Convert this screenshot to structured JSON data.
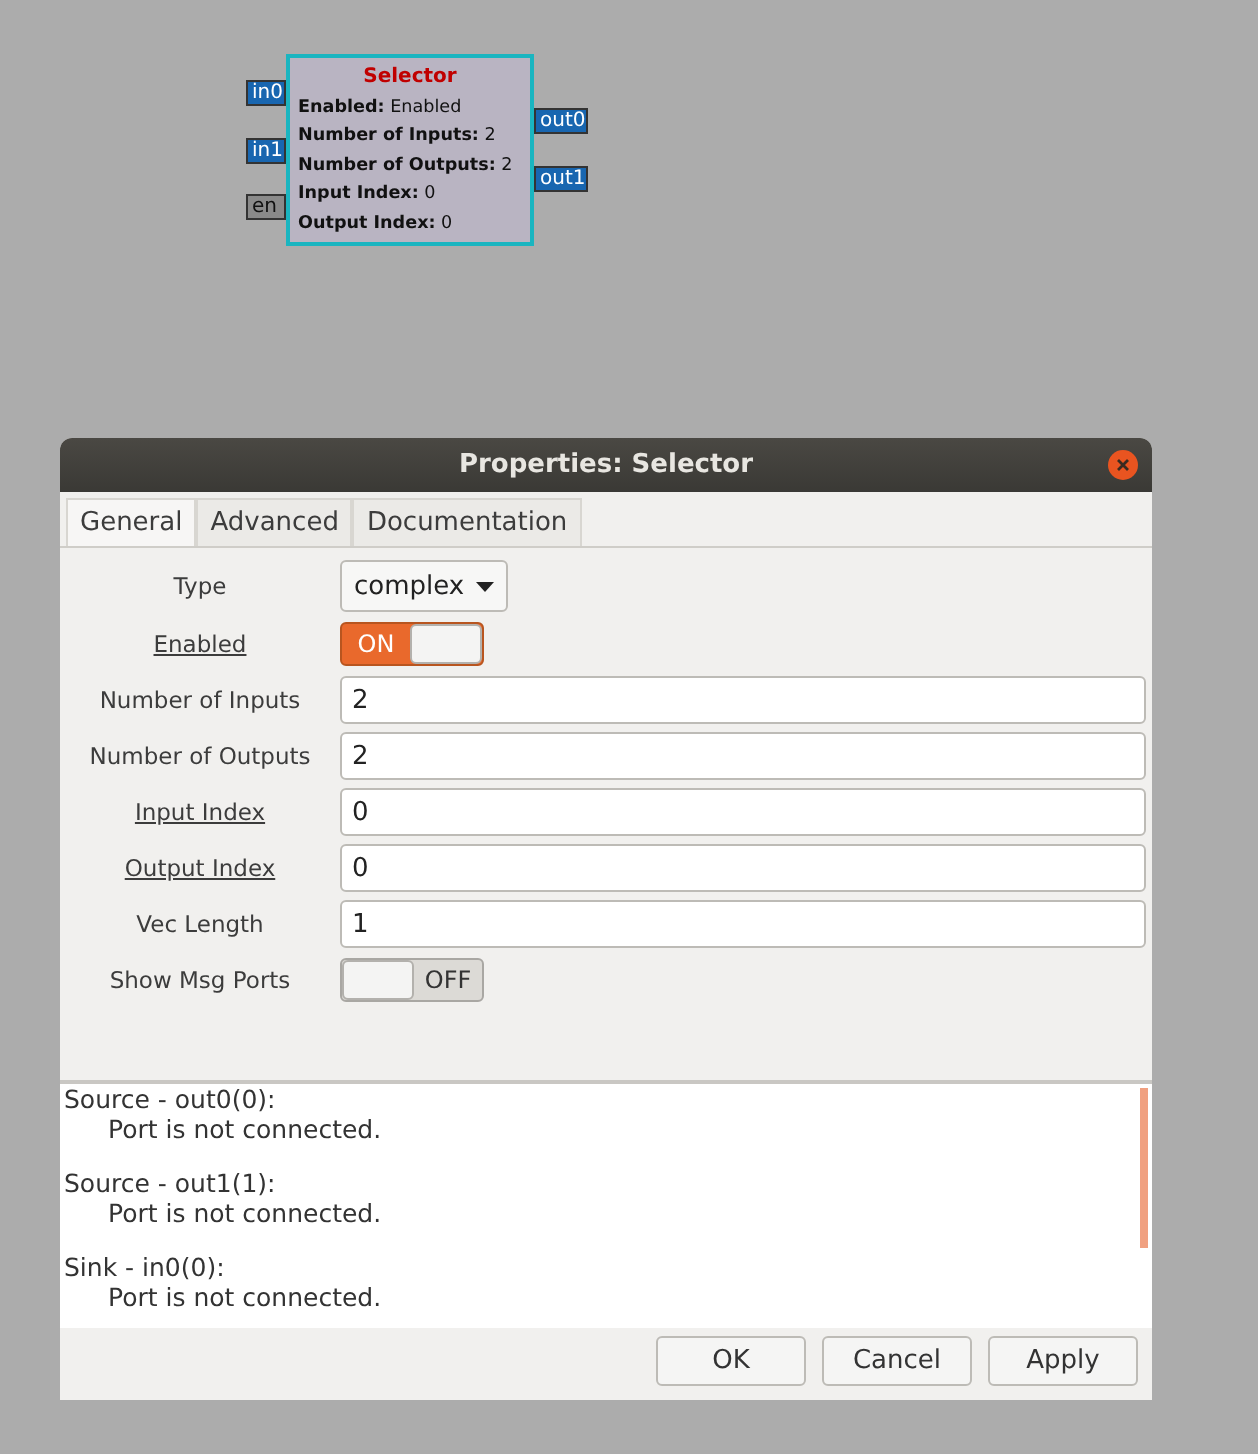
{
  "block": {
    "title": "Selector",
    "params": [
      {
        "name": "Enabled:",
        "value": "Enabled"
      },
      {
        "name": "Number of Inputs:",
        "value": "2"
      },
      {
        "name": "Number of Outputs:",
        "value": "2"
      },
      {
        "name": "Input Index:",
        "value": "0"
      },
      {
        "name": "Output Index:",
        "value": "0"
      }
    ],
    "inputs": [
      {
        "label": "in0",
        "kind": "stream"
      },
      {
        "label": "in1",
        "kind": "stream"
      },
      {
        "label": "en",
        "kind": "message"
      }
    ],
    "outputs": [
      {
        "label": "out0",
        "kind": "stream"
      },
      {
        "label": "out1",
        "kind": "stream"
      }
    ]
  },
  "dialog": {
    "title": "Properties: Selector",
    "tabs": [
      {
        "label": "General",
        "selected": true
      },
      {
        "label": "Advanced",
        "selected": false
      },
      {
        "label": "Documentation",
        "selected": false
      }
    ],
    "fields": [
      {
        "label": "Type",
        "underlined": false,
        "kind": "dropdown",
        "value": "complex"
      },
      {
        "label": "Enabled",
        "underlined": true,
        "kind": "switch",
        "on": true,
        "switch_text": "ON"
      },
      {
        "label": "Number of Inputs",
        "underlined": false,
        "kind": "entry",
        "value": "2"
      },
      {
        "label": "Number of Outputs",
        "underlined": false,
        "kind": "entry",
        "value": "2"
      },
      {
        "label": "Input Index",
        "underlined": true,
        "kind": "entry",
        "value": "0"
      },
      {
        "label": "Output Index",
        "underlined": true,
        "kind": "entry",
        "value": "0"
      },
      {
        "label": "Vec Length",
        "underlined": false,
        "kind": "entry",
        "value": "1"
      },
      {
        "label": "Show Msg Ports",
        "underlined": false,
        "kind": "switch",
        "on": false,
        "switch_text": "OFF"
      }
    ],
    "log": [
      {
        "heading": "Source - out0(0):",
        "message": "Port is not connected."
      },
      {
        "heading": "Source - out1(1):",
        "message": "Port is not connected."
      },
      {
        "heading": "Sink - in0(0):",
        "message": "Port is not connected."
      }
    ],
    "buttons": [
      "OK",
      "Cancel",
      "Apply"
    ]
  }
}
